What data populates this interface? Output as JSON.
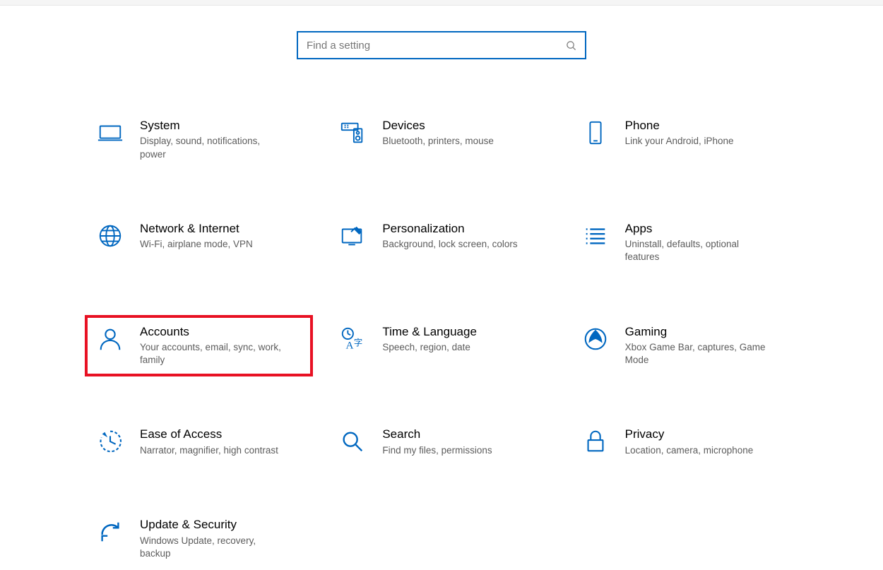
{
  "search": {
    "placeholder": "Find a setting"
  },
  "categories": [
    {
      "key": "system",
      "title": "System",
      "desc": "Display, sound, notifications, power",
      "highlight": false
    },
    {
      "key": "devices",
      "title": "Devices",
      "desc": "Bluetooth, printers, mouse",
      "highlight": false
    },
    {
      "key": "phone",
      "title": "Phone",
      "desc": "Link your Android, iPhone",
      "highlight": false
    },
    {
      "key": "network",
      "title": "Network & Internet",
      "desc": "Wi-Fi, airplane mode, VPN",
      "highlight": false
    },
    {
      "key": "personalization",
      "title": "Personalization",
      "desc": "Background, lock screen, colors",
      "highlight": false
    },
    {
      "key": "apps",
      "title": "Apps",
      "desc": "Uninstall, defaults, optional features",
      "highlight": false
    },
    {
      "key": "accounts",
      "title": "Accounts",
      "desc": "Your accounts, email, sync, work, family",
      "highlight": true
    },
    {
      "key": "time",
      "title": "Time & Language",
      "desc": "Speech, region, date",
      "highlight": false
    },
    {
      "key": "gaming",
      "title": "Gaming",
      "desc": "Xbox Game Bar, captures, Game Mode",
      "highlight": false
    },
    {
      "key": "ease",
      "title": "Ease of Access",
      "desc": "Narrator, magnifier, high contrast",
      "highlight": false
    },
    {
      "key": "search",
      "title": "Search",
      "desc": "Find my files, permissions",
      "highlight": false
    },
    {
      "key": "privacy",
      "title": "Privacy",
      "desc": "Location, camera, microphone",
      "highlight": false
    },
    {
      "key": "update",
      "title": "Update & Security",
      "desc": "Windows Update, recovery, backup",
      "highlight": false
    }
  ]
}
